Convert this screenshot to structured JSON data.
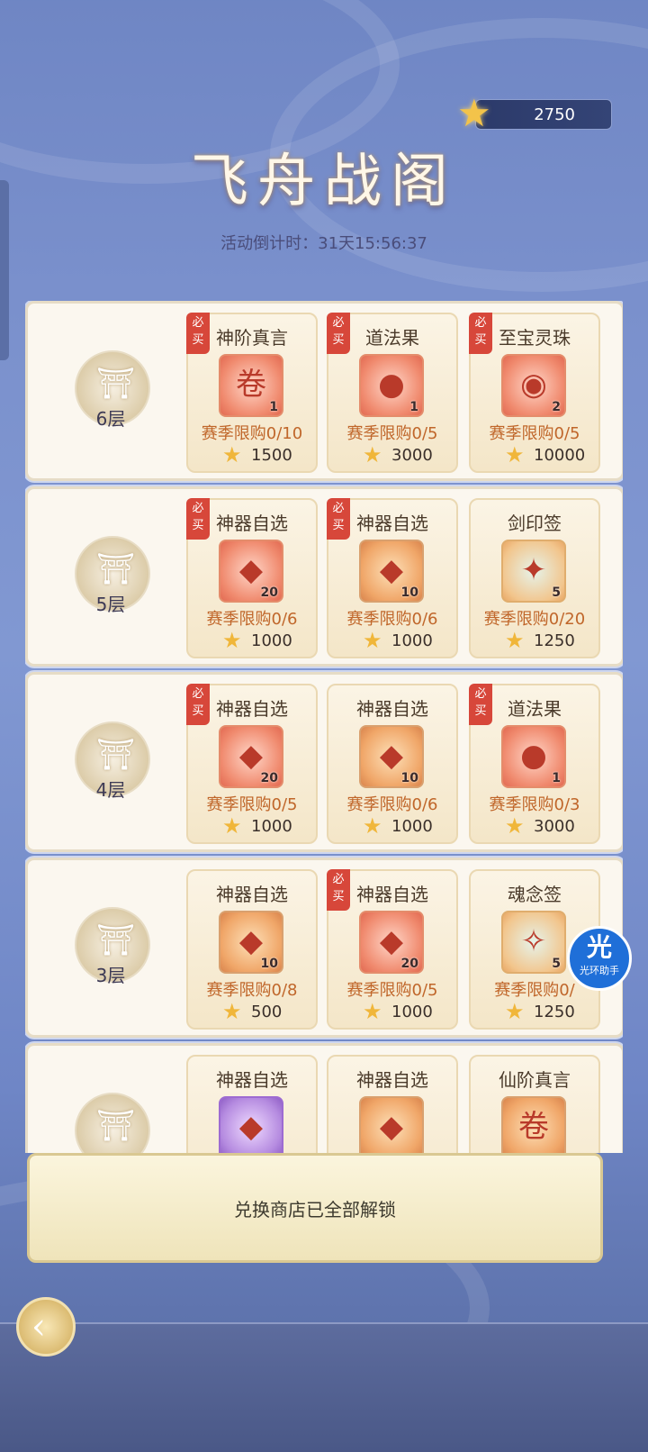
{
  "header": {
    "currency_value": "2750",
    "title": "飞舟战阁",
    "countdown": "活动倒计时：31天15:56:37"
  },
  "tiers": [
    {
      "label": "6层",
      "items": [
        {
          "name": "神阶真言",
          "must": "必买",
          "count": "1",
          "limit": "赛季限购0/10",
          "price": "1500",
          "color": "red",
          "icon": "scroll-bundle-icon"
        },
        {
          "name": "道法果",
          "must": "必买",
          "count": "1",
          "limit": "赛季限购0/5",
          "price": "3000",
          "color": "red",
          "icon": "peach-fruit-icon"
        },
        {
          "name": "至宝灵珠",
          "must": "必买",
          "count": "2",
          "limit": "赛季限购0/5",
          "price": "10000",
          "color": "red",
          "icon": "spirit-orb-icon"
        }
      ]
    },
    {
      "label": "5层",
      "items": [
        {
          "name": "神器自选",
          "must": "必买",
          "count": "20",
          "limit": "赛季限购0/6",
          "price": "1000",
          "color": "red",
          "icon": "artifact-chest-icon"
        },
        {
          "name": "神器自选",
          "must": "必买",
          "count": "10",
          "limit": "赛季限购0/6",
          "price": "1000",
          "color": "orange",
          "icon": "artifact-chest-icon"
        },
        {
          "name": "剑印签",
          "must": "",
          "count": "5",
          "limit": "赛季限购0/20",
          "price": "1250",
          "color": "teal",
          "icon": "sword-seal-icon"
        }
      ]
    },
    {
      "label": "4层",
      "items": [
        {
          "name": "神器自选",
          "must": "必买",
          "count": "20",
          "limit": "赛季限购0/5",
          "price": "1000",
          "color": "red",
          "icon": "artifact-chest-icon"
        },
        {
          "name": "神器自选",
          "must": "",
          "count": "10",
          "limit": "赛季限购0/6",
          "price": "1000",
          "color": "orange",
          "icon": "artifact-chest-icon"
        },
        {
          "name": "道法果",
          "must": "必买",
          "count": "1",
          "limit": "赛季限购0/3",
          "price": "3000",
          "color": "red",
          "icon": "peach-fruit-icon"
        }
      ]
    },
    {
      "label": "3层",
      "items": [
        {
          "name": "神器自选",
          "must": "",
          "count": "10",
          "limit": "赛季限购0/8",
          "price": "500",
          "color": "orange",
          "icon": "artifact-chest-icon"
        },
        {
          "name": "神器自选",
          "must": "必买",
          "count": "20",
          "limit": "赛季限购0/5",
          "price": "1000",
          "color": "red",
          "icon": "artifact-chest-icon"
        },
        {
          "name": "魂念签",
          "must": "",
          "count": "5",
          "limit": "赛季限购0/",
          "price": "1250",
          "color": "teal",
          "icon": "soul-seal-icon"
        }
      ]
    },
    {
      "label": "",
      "items": [
        {
          "name": "神器自选",
          "must": "",
          "count": "",
          "limit": "",
          "price": "",
          "color": "purple",
          "icon": "artifact-chest-icon"
        },
        {
          "name": "神器自选",
          "must": "",
          "count": "",
          "limit": "",
          "price": "",
          "color": "orange",
          "icon": "artifact-chest-icon"
        },
        {
          "name": "仙阶真言",
          "must": "",
          "count": "",
          "limit": "",
          "price": "",
          "color": "orange",
          "icon": "scroll-bundle-icon"
        }
      ]
    }
  ],
  "banner": {
    "text": "兑换商店已全部解锁"
  },
  "helper": {
    "big": "光",
    "small": "光环助手"
  }
}
